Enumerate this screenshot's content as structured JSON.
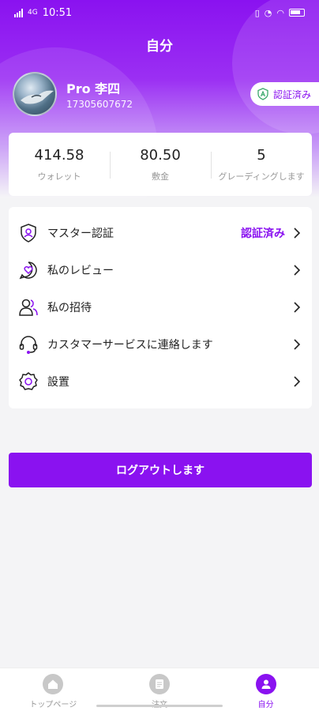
{
  "status_bar": {
    "time": "10:51",
    "network": "4G"
  },
  "header": {
    "title": "自分"
  },
  "profile": {
    "name": "Pro 李四",
    "phone": "17305607672",
    "verified_label": "認証済み"
  },
  "stats": [
    {
      "value": "414.58",
      "label": "ウォレット"
    },
    {
      "value": "80.50",
      "label": "敷金"
    },
    {
      "value": "5",
      "label": "グレーディングします"
    }
  ],
  "menu": {
    "master_auth": {
      "label": "マスター認証",
      "status": "認証済み",
      "icon": "shield-person-icon"
    },
    "reviews": {
      "label": "私のレビュー",
      "icon": "heart-chat-icon"
    },
    "invites": {
      "label": "私の招待",
      "icon": "users-icon"
    },
    "support": {
      "label": "カスタマーサービスに連絡します",
      "icon": "headset-icon"
    },
    "settings": {
      "label": "設置",
      "icon": "gear-icon"
    }
  },
  "logout_label": "ログアウトします",
  "nav": [
    {
      "label": "トップページ",
      "icon": "home-icon",
      "active": false
    },
    {
      "label": "注文",
      "icon": "document-icon",
      "active": false
    },
    {
      "label": "自分",
      "icon": "person-icon",
      "active": true
    }
  ],
  "colors": {
    "accent": "#8a12f0",
    "background": "#f4f4f6"
  }
}
